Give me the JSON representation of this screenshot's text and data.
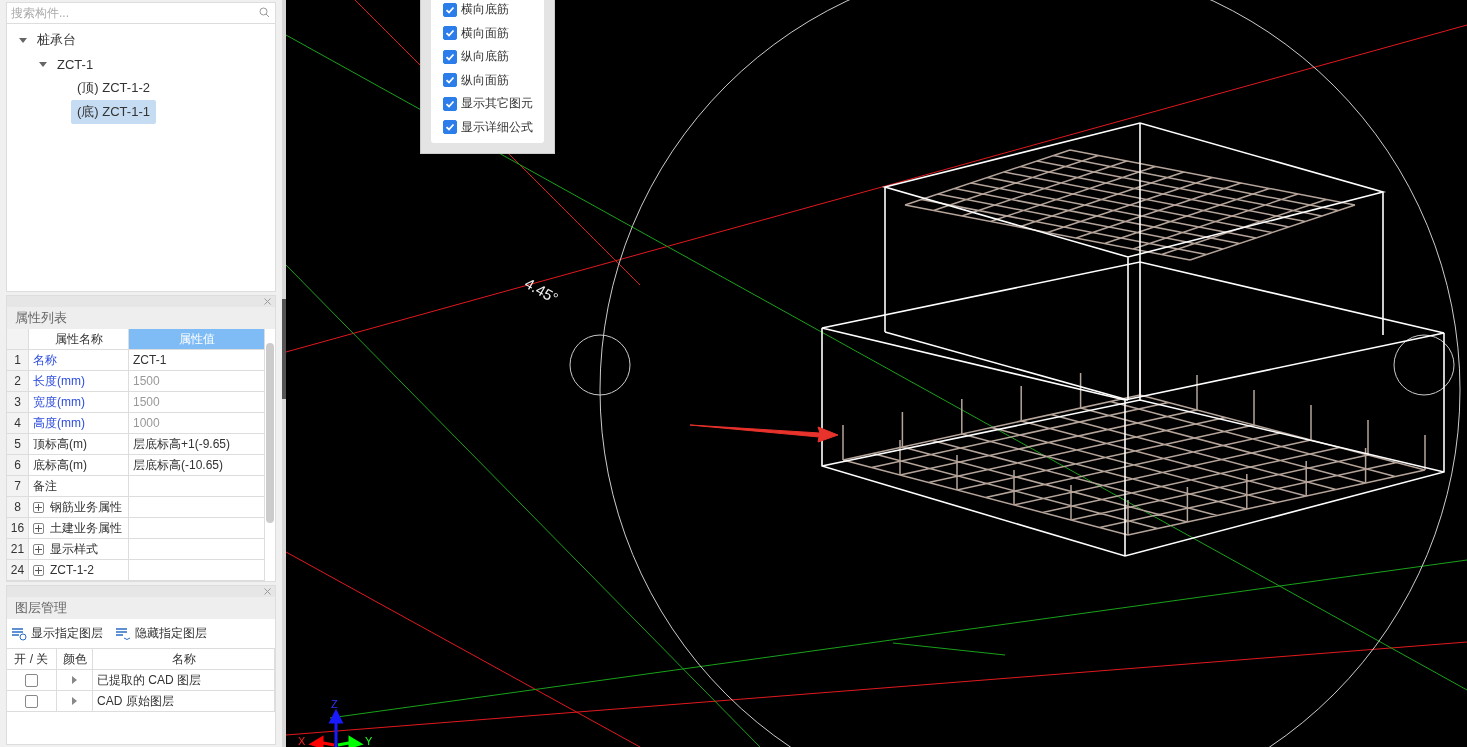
{
  "search": {
    "placeholder": "搜索构件..."
  },
  "tree": [
    {
      "label": "桩承台",
      "expanded": true,
      "children": [
        {
          "label": "ZCT-1",
          "expanded": true,
          "children": [
            {
              "prefix": "(顶)",
              "label": "ZCT-1-2",
              "selected": false
            },
            {
              "prefix": "(底)",
              "label": "ZCT-1-1",
              "selected": true
            }
          ]
        }
      ]
    }
  ],
  "properties": {
    "title": "属性列表",
    "columns": [
      {
        "label": "属性名称",
        "selected": false
      },
      {
        "label": "属性值",
        "selected": true
      }
    ],
    "rows": [
      {
        "index": "1",
        "name": "名称",
        "value": "ZCT-1",
        "public": true,
        "readonly": false,
        "kind": "plain"
      },
      {
        "index": "2",
        "name": "长度(mm)",
        "value": "1500",
        "public": true,
        "readonly": true,
        "kind": "plain"
      },
      {
        "index": "3",
        "name": "宽度(mm)",
        "value": "1500",
        "public": true,
        "readonly": true,
        "kind": "plain"
      },
      {
        "index": "4",
        "name": "高度(mm)",
        "value": "1000",
        "public": true,
        "readonly": true,
        "kind": "plain"
      },
      {
        "index": "5",
        "name": "顶标高(m)",
        "value": "层底标高+1(-9.65)",
        "public": false,
        "readonly": false,
        "kind": "plain"
      },
      {
        "index": "6",
        "name": "底标高(m)",
        "value": "层底标高(-10.65)",
        "public": false,
        "readonly": false,
        "kind": "plain"
      },
      {
        "index": "7",
        "name": "备注",
        "public": false,
        "kind": "plain"
      },
      {
        "index": "8",
        "name": "钢筋业务属性",
        "kind": "group",
        "expanded": false
      },
      {
        "index": "16",
        "name": "土建业务属性",
        "kind": "group",
        "expanded": false
      },
      {
        "index": "21",
        "name": "显示样式",
        "kind": "group",
        "expanded": false
      },
      {
        "index": "24",
        "name": "ZCT-1-2",
        "kind": "group",
        "expanded": false
      }
    ]
  },
  "layers": {
    "title": "图层管理",
    "actions": [
      {
        "label": "显示指定图层",
        "kind": "show"
      },
      {
        "label": "隐藏指定图层",
        "kind": "hide"
      }
    ],
    "columns": [
      "开 / 关",
      "颜色",
      "名称"
    ],
    "rows": [
      {
        "checked": false,
        "name": "已提取的 CAD 图层"
      },
      {
        "checked": false,
        "name": "CAD 原始图层"
      }
    ]
  },
  "display_options": [
    {
      "label": "横向底筋",
      "checked": true
    },
    {
      "label": "横向面筋",
      "checked": true
    },
    {
      "label": "纵向底筋",
      "checked": true
    },
    {
      "label": "纵向面筋",
      "checked": true
    },
    {
      "label": "显示其它图元",
      "checked": true
    },
    {
      "label": "显示详细公式",
      "checked": true
    }
  ],
  "viewport": {
    "angle_label": "4.45°",
    "axes": [
      "Z",
      "X",
      "Y"
    ]
  }
}
